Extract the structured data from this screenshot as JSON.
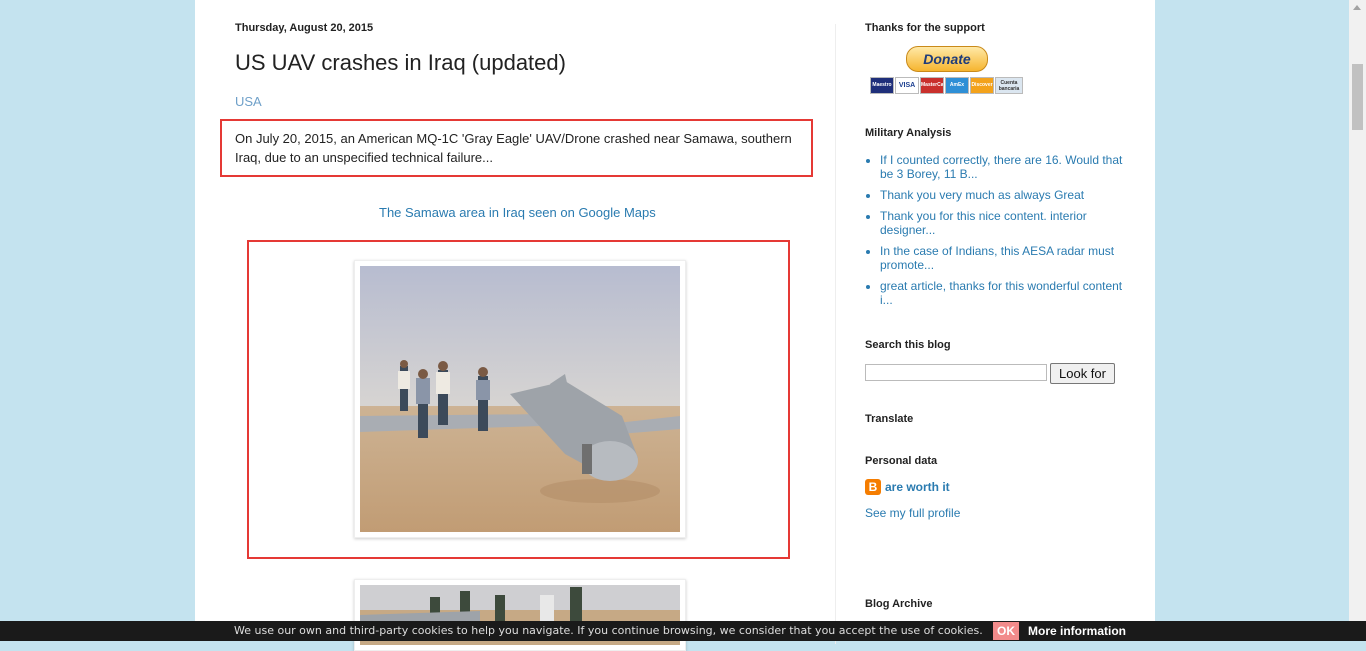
{
  "post": {
    "date": "Thursday, August 20, 2015",
    "title": "US UAV crashes in Iraq (updated)",
    "label": "USA",
    "snippet": "On July 20, 2015, an American MQ-1C 'Gray Eagle' UAV/Drone crashed near Samawa, southern Iraq, due to an unspecified technical failure...",
    "maps_link": "The Samawa area in Iraq seen on Google Maps"
  },
  "sidebar": {
    "support_heading": "Thanks for the support",
    "donate_label": "Donate",
    "cards": [
      "Maestro",
      "VISA",
      "MasterCard",
      "AmEx",
      "Discover",
      "Cuenta bancaria"
    ],
    "analysis_heading": "Military Analysis",
    "analysis_items": [
      "If I counted correctly, there are 16. Would that be 3 Borey, 11 B...",
      "Thank you very much as always Great",
      "Thank you for this nice content. interior designer...",
      "In the case of Indians, this AESA radar must promote...",
      "great article, thanks for this wonderful content i..."
    ],
    "search_heading": "Search this blog",
    "search_button": "Look for",
    "translate_heading": "Translate",
    "personal_heading": "Personal data",
    "profile_name": "are worth it",
    "full_profile": "See my full profile",
    "archive_heading": "Blog Archive"
  },
  "cookie": {
    "text": "We use our own and third-party cookies to help you navigate. If you continue browsing, we consider that you accept the use of cookies.",
    "ok": "OK",
    "more": "More information"
  },
  "colors": {
    "page_background": "#c4e3ef",
    "link": "#2a7bb0",
    "highlight_border": "#e53935"
  }
}
